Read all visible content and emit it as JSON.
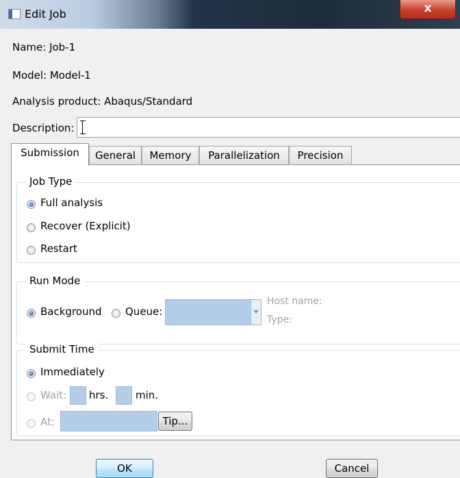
{
  "window": {
    "title": "Edit Job",
    "close_glyph": "x",
    "icon": "window-app-icon"
  },
  "info": {
    "name": "Name:  Job-1",
    "model": "Model:  Model-1",
    "analysis_product": "Analysis product:  Abaqus/Standard",
    "description_label": "Description:",
    "description_value": ""
  },
  "tabs": [
    "Submission",
    "General",
    "Memory",
    "Parallelization",
    "Precision"
  ],
  "active_tab": "Submission",
  "job_type": {
    "title": "Job Type",
    "options": [
      "Full analysis",
      "Recover (Explicit)",
      "Restart"
    ],
    "selected": "Full analysis"
  },
  "run_mode": {
    "title": "Run Mode",
    "background_label": "Background",
    "queue_label": "Queue:",
    "selected": "Background",
    "host_name_label": "Host name:",
    "type_label": "Type:"
  },
  "submit_time": {
    "title": "Submit Time",
    "immediately_label": "Immediately",
    "wait_label": "Wait:",
    "hrs_label": "hrs.",
    "min_label": "min.",
    "at_label": "At:",
    "tip_label": "Tip...",
    "selected": "Immediately"
  },
  "buttons": {
    "ok": "OK",
    "cancel": "Cancel"
  },
  "colors": {
    "field_disabled": "#b3cdeb",
    "radio_selected": "#1f4e9a"
  }
}
